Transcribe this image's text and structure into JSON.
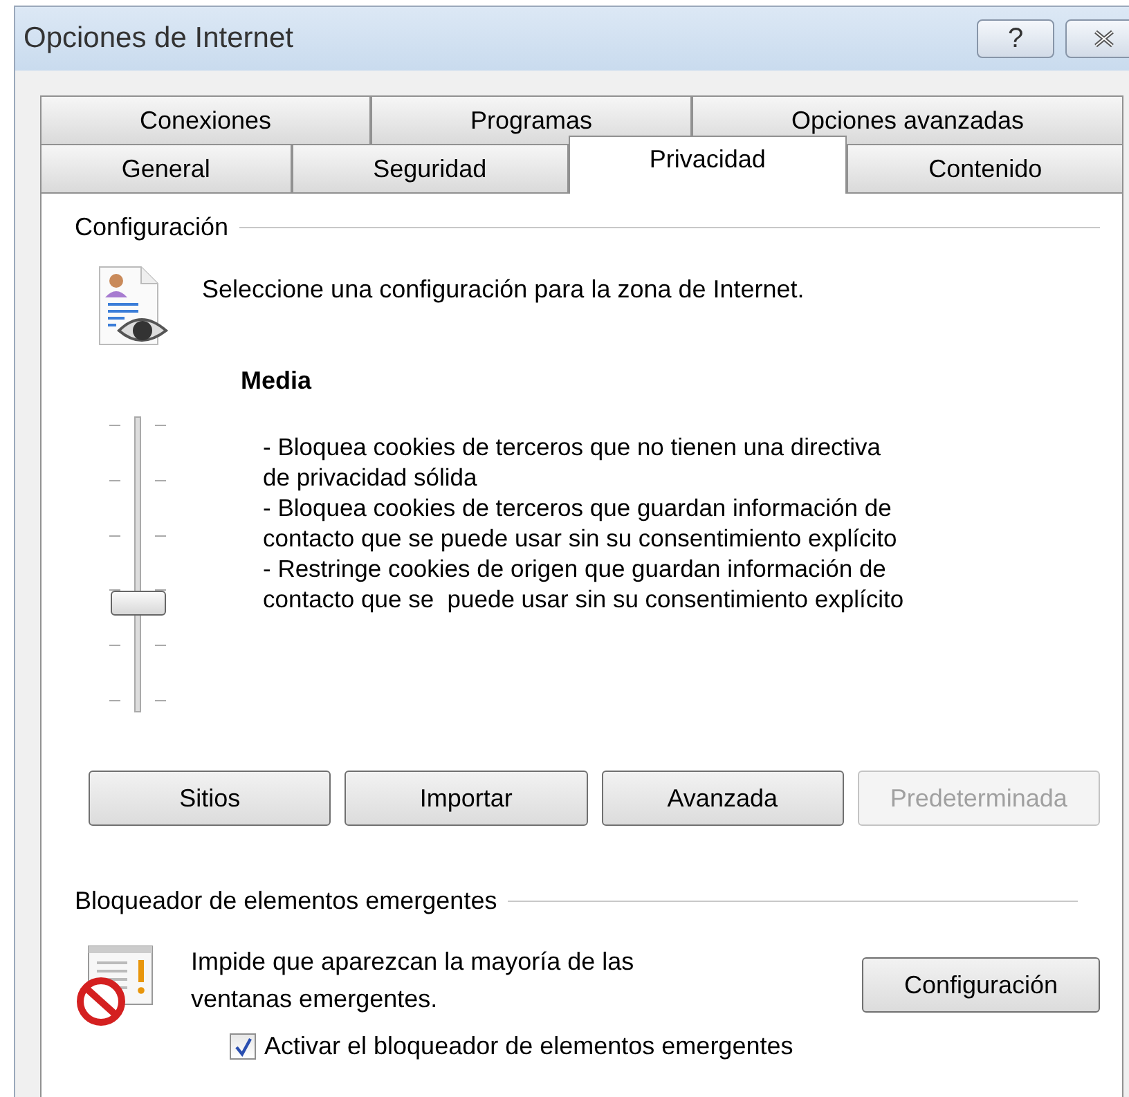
{
  "window": {
    "title": "Opciones de Internet",
    "help_button": "?"
  },
  "tab_rows": [
    [
      {
        "label": "Conexiones",
        "selected": false
      },
      {
        "label": "Programas",
        "selected": false
      },
      {
        "label": "Opciones avanzadas",
        "selected": false
      }
    ],
    [
      {
        "label": "General",
        "selected": false
      },
      {
        "label": "Seguridad",
        "selected": false
      },
      {
        "label": "Privacidad",
        "selected": true
      },
      {
        "label": "Contenido",
        "selected": false
      }
    ]
  ],
  "privacy": {
    "heading": "Configuración",
    "prompt": "Seleccione una configuración para la zona de Internet.",
    "slider": {
      "level": 0.4
    },
    "level_name": "Media",
    "description": [
      "- Bloquea cookies de terceros que no tienen una directiva",
      "de privacidad sólida",
      "- Bloquea cookies de terceros que guardan información de",
      "contacto que se puede usar sin su consentimiento explícito",
      "- Restringe cookies de origen que guardan información de",
      "contacto que se  puede usar sin su consentimiento explícito"
    ],
    "buttons": [
      {
        "label": "Sitios",
        "disabled": false
      },
      {
        "label": "Importar",
        "disabled": false
      },
      {
        "label": "Avanzada",
        "disabled": false
      },
      {
        "label": "Predeterminada",
        "disabled": true
      }
    ]
  },
  "popup_blocker": {
    "heading": "Bloqueador de elementos emergentes",
    "text": [
      "Impide que aparezcan la mayoría de las",
      "ventanas emergentes."
    ],
    "button": "Configuración",
    "checkbox": {
      "label": "Activar el bloqueador de elementos emergentes",
      "checked": true
    }
  }
}
